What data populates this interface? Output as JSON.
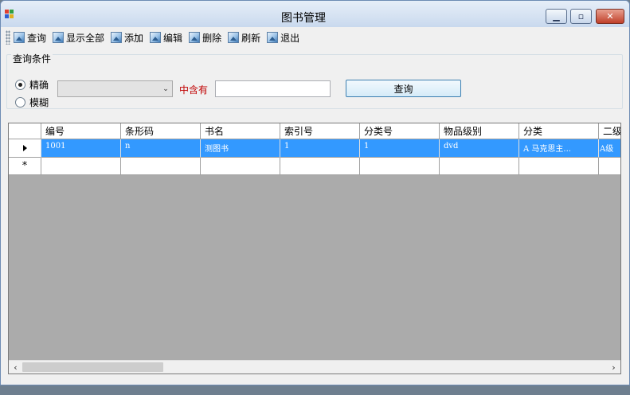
{
  "window": {
    "title": "图书管理"
  },
  "toolbar": {
    "items": [
      {
        "label": "查询",
        "icon": "image-icon"
      },
      {
        "label": "显示全部",
        "icon": "image-icon"
      },
      {
        "label": "添加",
        "icon": "image-icon"
      },
      {
        "label": "编辑",
        "icon": "image-icon"
      },
      {
        "label": "删除",
        "icon": "image-icon"
      },
      {
        "label": "刷新",
        "icon": "image-icon"
      },
      {
        "label": "退出",
        "icon": "image-icon"
      }
    ]
  },
  "query": {
    "group_title": "查询条件",
    "radio_exact": "精确",
    "radio_fuzzy": "模糊",
    "selected_mode": "精确",
    "field_value": "",
    "contains_label": "中含有",
    "input_value": "",
    "button_label": "查询"
  },
  "grid": {
    "columns": [
      "编号",
      "条形码",
      "书名",
      "索引号",
      "分类号",
      "物品级别",
      "分类",
      "二级"
    ],
    "rows": [
      [
        "1001",
        "n",
        "测图书",
        "1",
        "1",
        "dvd",
        "A  马克思主...",
        "A级"
      ]
    ],
    "selected_row": 0
  },
  "colors": {
    "selection": "#3399ff",
    "contains_label": "#c00000",
    "grid_background": "#ababab",
    "window_background": "#f0f0f0"
  }
}
